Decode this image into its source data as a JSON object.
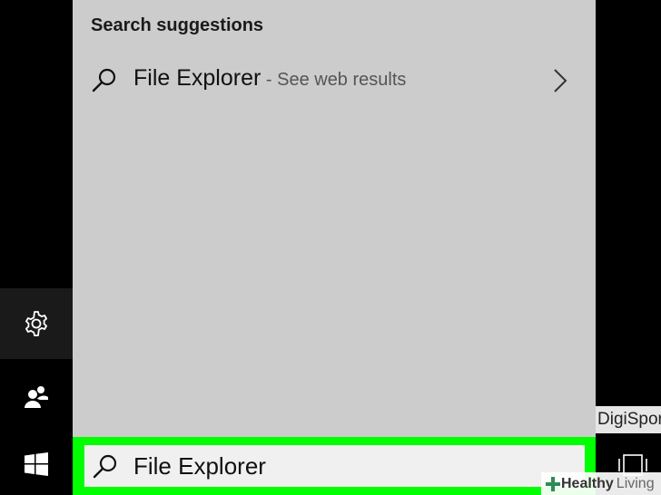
{
  "panel": {
    "heading": "Search suggestions",
    "suggestion": {
      "main": "File Explorer",
      "sub": " - See web results"
    }
  },
  "search": {
    "value": "File Explorer"
  },
  "background": {
    "partial_label": "DigiSpor",
    "watermark_bold": "Healthy",
    "watermark_light": "Living"
  },
  "colors": {
    "panel_bg": "#cccccc",
    "highlight": "#00ff00",
    "taskbar": "#000000",
    "search_bg": "#f0f0f0"
  },
  "icons": [
    "gear-icon",
    "people-icon",
    "windows-start-icon",
    "search-icon",
    "chevron-right-icon",
    "tablet-mode-icon",
    "plus-icon"
  ]
}
